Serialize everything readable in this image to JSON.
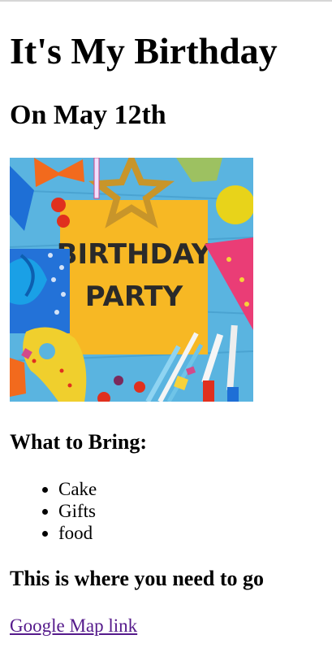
{
  "page": {
    "title": "It's My Birthday",
    "date_heading": "On May 12th"
  },
  "hero_image": {
    "line1": "BIRTHDAY",
    "line2": "PARTY"
  },
  "bring": {
    "heading": "What to Bring:",
    "items": [
      "Cake",
      "Gifts",
      "food"
    ]
  },
  "directions": {
    "heading": "This is where you need to go",
    "link_label": "Google Map link"
  }
}
